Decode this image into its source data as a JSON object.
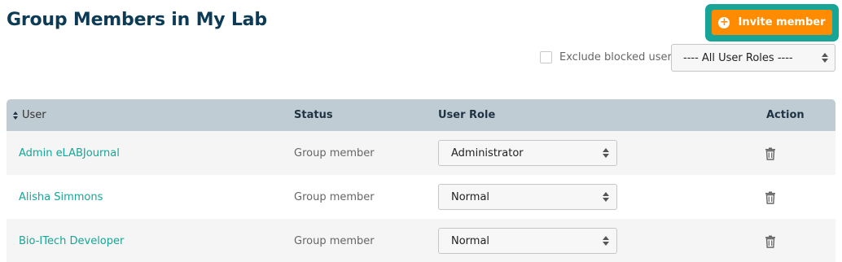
{
  "page": {
    "title": "Group Members in My Lab"
  },
  "toolbar": {
    "invite_label": "Invite member",
    "exclude_label": "Exclude blocked users",
    "exclude_checked": false,
    "role_filter_value": "---- All User Roles ----"
  },
  "table": {
    "headers": {
      "user": "User",
      "status": "Status",
      "role": "User Role",
      "action": "Action"
    },
    "rows": [
      {
        "user": "Admin eLABJournal",
        "status": "Group member",
        "role": "Administrator"
      },
      {
        "user": "Alisha Simmons",
        "status": "Group member",
        "role": "Normal"
      },
      {
        "user": "Bio-ITech Developer",
        "status": "Group member",
        "role": "Normal"
      }
    ]
  },
  "icons": [
    "plus-circle-icon",
    "sort-icon",
    "select-arrows-icon",
    "trash-icon"
  ],
  "colors": {
    "title": "#0d3b55",
    "accent": "#16a596",
    "invite": "#ff8c00",
    "header_bg": "#c0ccd4"
  }
}
